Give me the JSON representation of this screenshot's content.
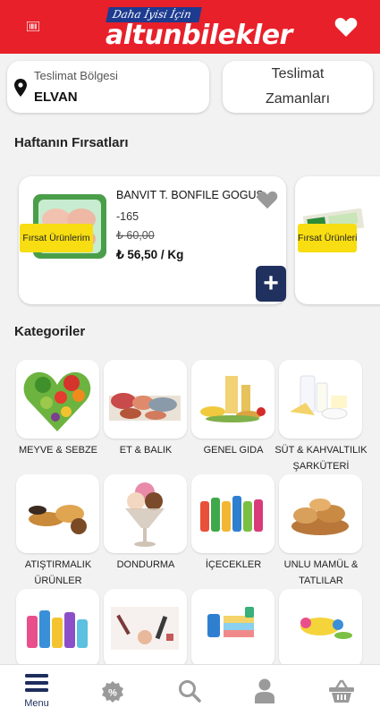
{
  "header": {
    "tagline": "Daha İyisi İçin",
    "brand": "altunbilekler",
    "colors": {
      "brand_red": "#e8202a",
      "navy": "#20305f",
      "badge_yellow": "#f7dd11"
    }
  },
  "delivery": {
    "region_label": "Teslimat Bölgesi",
    "region_value": "ELVAN",
    "time_label": "Teslimat Zamanları"
  },
  "deals": {
    "title": "Haftanın Fırsatları",
    "products": [
      {
        "name": "BANVIT T. BONFILE GOGUS",
        "discount": "-165",
        "old_price": "₺ 60,00",
        "new_price": "₺ 56,50 / Kg",
        "badge": "Fırsat Ürünlerim"
      },
      {
        "badge": "Fırsat Ürünlerim"
      }
    ]
  },
  "categories": {
    "title": "Kategoriler",
    "items": [
      {
        "label": "MEYVE & SEBZE",
        "icon": "fruits-vegetables-image"
      },
      {
        "label": "ET & BALIK",
        "icon": "meat-fish-image"
      },
      {
        "label": "GENEL GIDA",
        "icon": "general-food-image"
      },
      {
        "label": "SÜT & KAHVALTILIK ŞARKÜTERİ",
        "icon": "dairy-breakfast-image"
      },
      {
        "label": "ATIŞTIRMALIK ÜRÜNLER",
        "icon": "snacks-image"
      },
      {
        "label": "DONDURMA",
        "icon": "ice-cream-image"
      },
      {
        "label": "İÇECEKLER",
        "icon": "beverages-image"
      },
      {
        "label": "UNLU MAMÜL & TATLILAR",
        "icon": "bakery-image"
      },
      {
        "label": "",
        "icon": "cleaning-image"
      },
      {
        "label": "",
        "icon": "cosmetics-image"
      },
      {
        "label": "",
        "icon": "laundry-image"
      },
      {
        "label": "",
        "icon": "baby-pet-image"
      }
    ]
  },
  "bottom_nav": {
    "menu_label": "Menu"
  }
}
